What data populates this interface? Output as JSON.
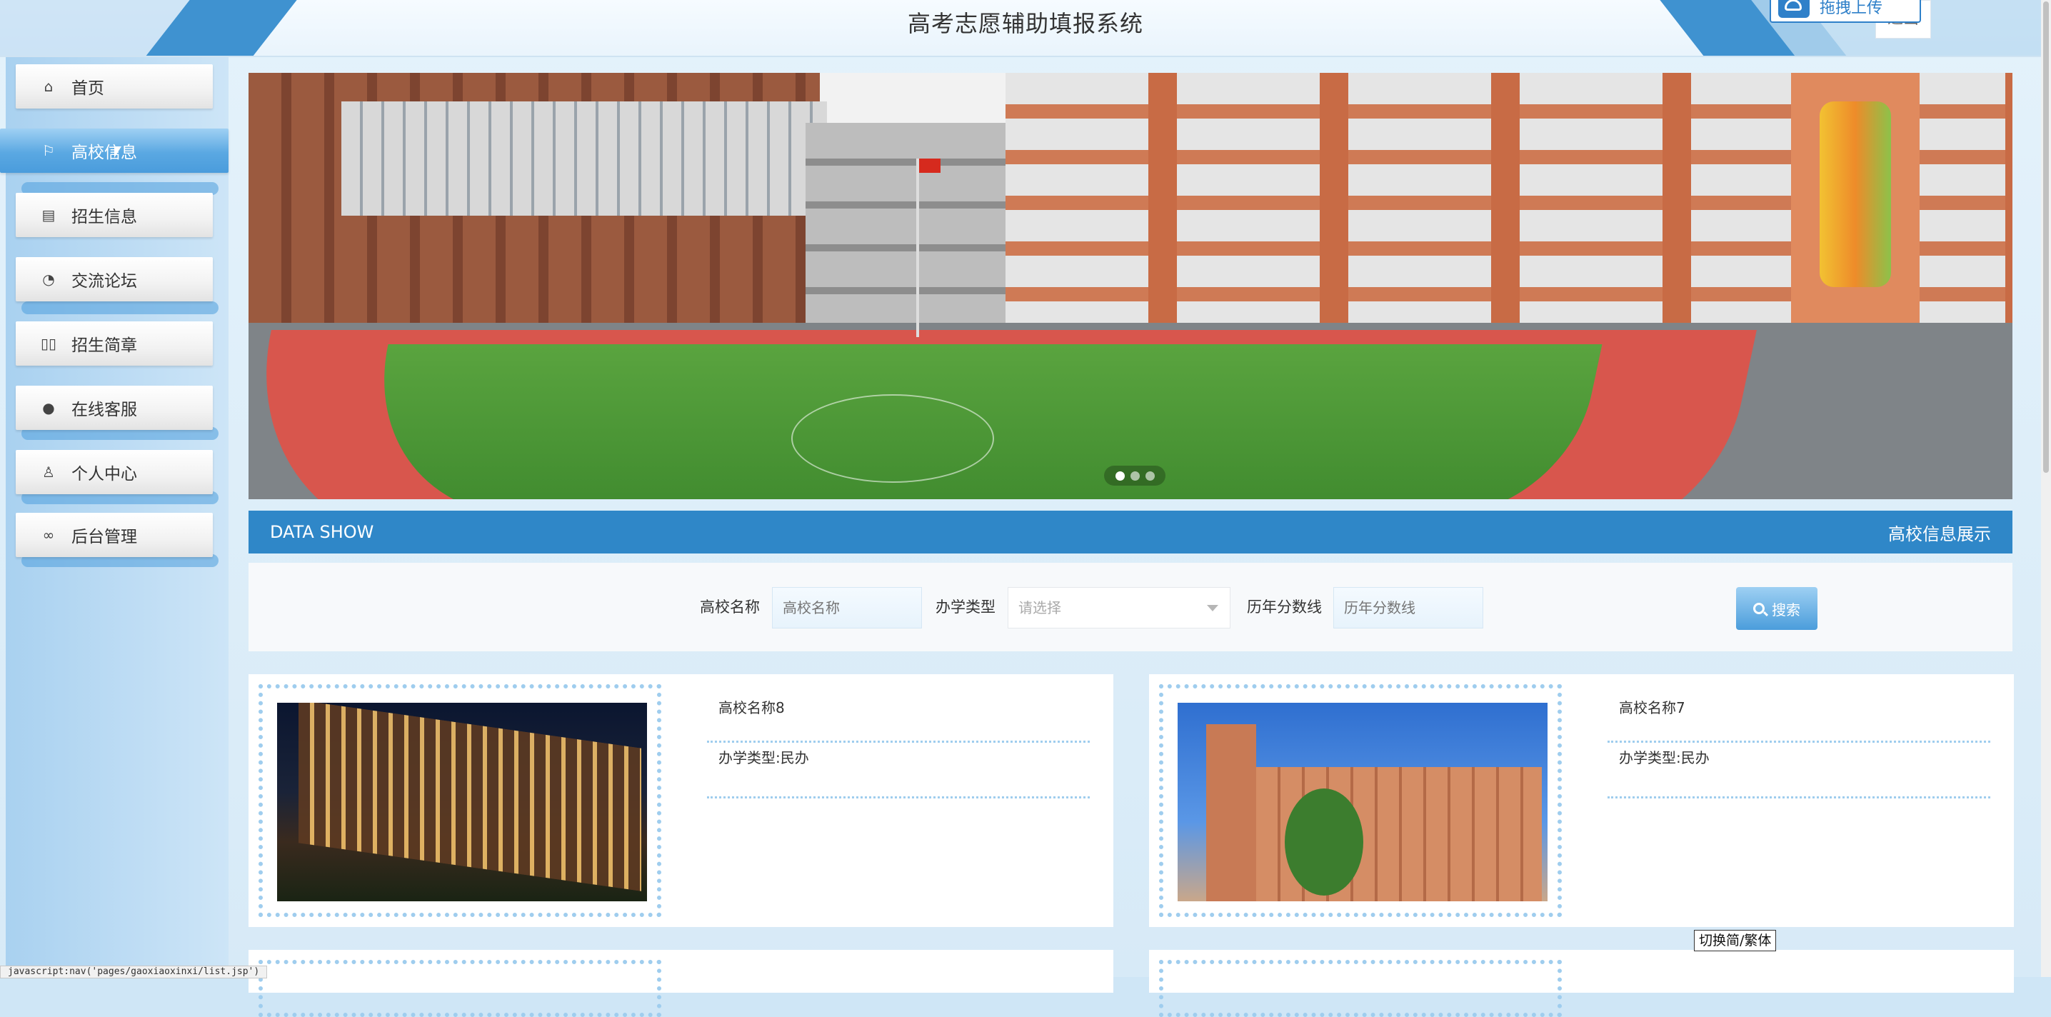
{
  "header": {
    "site_title": "高考志愿辅助填报系统",
    "upload_label": "拖拽上传",
    "logout_label": "退出"
  },
  "sidebar": {
    "items": [
      {
        "label": "首页",
        "icon": "home-icon"
      },
      {
        "label": "高校信息",
        "icon": "flag-icon",
        "active": true
      },
      {
        "label": "招生信息",
        "icon": "document-icon"
      },
      {
        "label": "交流论坛",
        "icon": "palette-icon"
      },
      {
        "label": "招生简章",
        "icon": "book-icon"
      },
      {
        "label": "在线客服",
        "icon": "chat-icon"
      },
      {
        "label": "个人中心",
        "icon": "user-icon"
      },
      {
        "label": "后台管理",
        "icon": "link-icon"
      }
    ]
  },
  "banner": {
    "slides": 3,
    "active_slide": 1
  },
  "data_bar": {
    "left": "DATA SHOW",
    "right": "高校信息展示"
  },
  "search": {
    "name_label": "高校名称",
    "name_placeholder": "高校名称",
    "type_label": "办学类型",
    "type_placeholder": "请选择",
    "score_label": "历年分数线",
    "score_placeholder": "历年分数线",
    "button_label": "搜索"
  },
  "cards": [
    {
      "name": "高校名称8",
      "type": "办学类型:民办"
    },
    {
      "name": "高校名称7",
      "type": "办学类型:民办"
    }
  ],
  "tooltip": "切换简/繁体",
  "statusbar": "javascript:nav('pages/gaoxiaoxinxi/list.jsp')",
  "colors": {
    "primary": "#2f87c8",
    "sidebar_active": "#4a9cdc",
    "dot_border": "#9fcdee"
  }
}
